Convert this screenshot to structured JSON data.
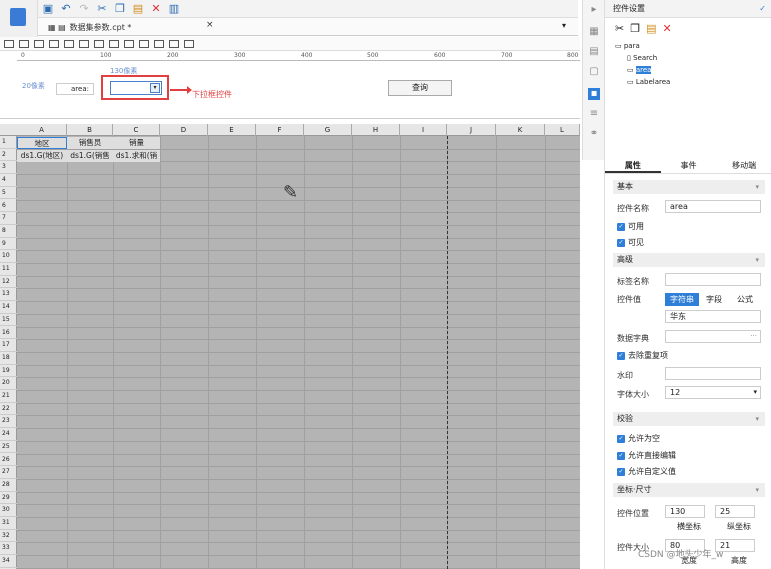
{
  "app": {
    "title": "数据集参数.cpt *"
  },
  "ruler": {
    "ticks": [
      "0",
      "100",
      "200",
      "300",
      "400",
      "500",
      "600",
      "700",
      "800"
    ]
  },
  "param": {
    "dim_top": "130像素",
    "dim_left": "20像素",
    "label_text": "area:",
    "annotation": "下拉框控件",
    "query_button": "查询"
  },
  "sheet": {
    "columns": [
      "A",
      "B",
      "C",
      "D",
      "E",
      "F",
      "G",
      "H",
      "I",
      "J",
      "K",
      "L"
    ],
    "rows": [
      "1",
      "2",
      "3",
      "4",
      "5",
      "6",
      "7",
      "8",
      "9",
      "10",
      "11",
      "12",
      "13",
      "14",
      "15",
      "16",
      "17",
      "18",
      "19",
      "20",
      "21",
      "22",
      "23",
      "24",
      "25",
      "26",
      "27",
      "28",
      "29",
      "30",
      "31",
      "32",
      "33",
      "34"
    ],
    "headers": [
      "地区",
      "销售员",
      "销量"
    ],
    "data": [
      "ds1.G(地区)",
      "ds1.G(销售",
      "ds1.求和(销"
    ]
  },
  "rpanel": {
    "title": "控件设置",
    "tree": [
      "para",
      "Search",
      "area",
      "Labelarea"
    ],
    "tabs": [
      "属性",
      "事件",
      "移动端"
    ],
    "basic": "基本",
    "name_label": "控件名称",
    "name_value": "area",
    "enabled": "可用",
    "visible": "可见",
    "advanced": "高级",
    "tag_name": "标签名称",
    "ctrl_value": "控件值",
    "seg": [
      "字符串",
      "字段",
      "公式"
    ],
    "value": "华东",
    "dict": "数据字典",
    "dedup": "去除重复项",
    "watermark": "水印",
    "fontsize_label": "字体大小",
    "fontsize": "12",
    "validate": "校验",
    "allow_empty": "允许为空",
    "allow_edit": "允许直接编辑",
    "allow_custom": "允许自定义值",
    "coord": "坐标·尺寸",
    "pos_label": "控件位置",
    "pos_x": "130",
    "pos_y": "25",
    "hcoord": "横坐标",
    "vcoord": "纵坐标",
    "size_label": "控件大小",
    "w": "80",
    "h": "21",
    "wlabel": "宽度",
    "hlabel": "高度",
    "ellipsis": "···"
  },
  "watermark_text": "CSDN @地头少年_w"
}
